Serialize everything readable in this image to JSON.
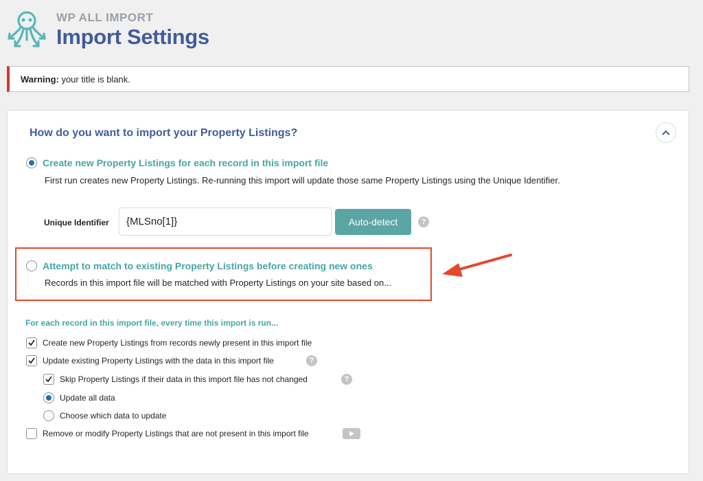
{
  "header": {
    "brand": "WP ALL IMPORT",
    "title": "Import Settings"
  },
  "notice": {
    "label": "Warning:",
    "text": " your title is blank."
  },
  "panel": {
    "question": "How do you want to import your Property Listings?",
    "option_create": {
      "title": "Create new Property Listings for each record in this import file",
      "description": "First run creates new Property Listings. Re-running this import will update those same Property Listings using the Unique Identifier.",
      "selected": true
    },
    "unique_identifier": {
      "label": "Unique Identifier",
      "value": "{MLSno[1]}",
      "button": "Auto-detect"
    },
    "option_match": {
      "title": "Attempt to match to existing Property Listings before creating new ones",
      "description": "Records in this import file will be matched with Property Listings on your site based on...",
      "selected": false
    },
    "section_label": "For each record in this import file, every time this import is run...",
    "items": [
      {
        "label": "Create new Property Listings from records newly present in this import file",
        "checked": true
      },
      {
        "label": "Update existing Property Listings with the data in this import file",
        "checked": true
      },
      {
        "label": "Skip Property Listings if their data in this import file has not changed",
        "checked": true
      },
      {
        "label": "Update all data",
        "checked": true
      },
      {
        "label": "Choose which data to update",
        "checked": false
      },
      {
        "label": "Remove or modify Property Listings that are not present in this import file",
        "checked": false
      }
    ]
  },
  "colors": {
    "accent_teal": "#46a5a5",
    "title_blue": "#425c9a",
    "warning_red": "#d63638",
    "highlight_red": "#e5482d"
  }
}
